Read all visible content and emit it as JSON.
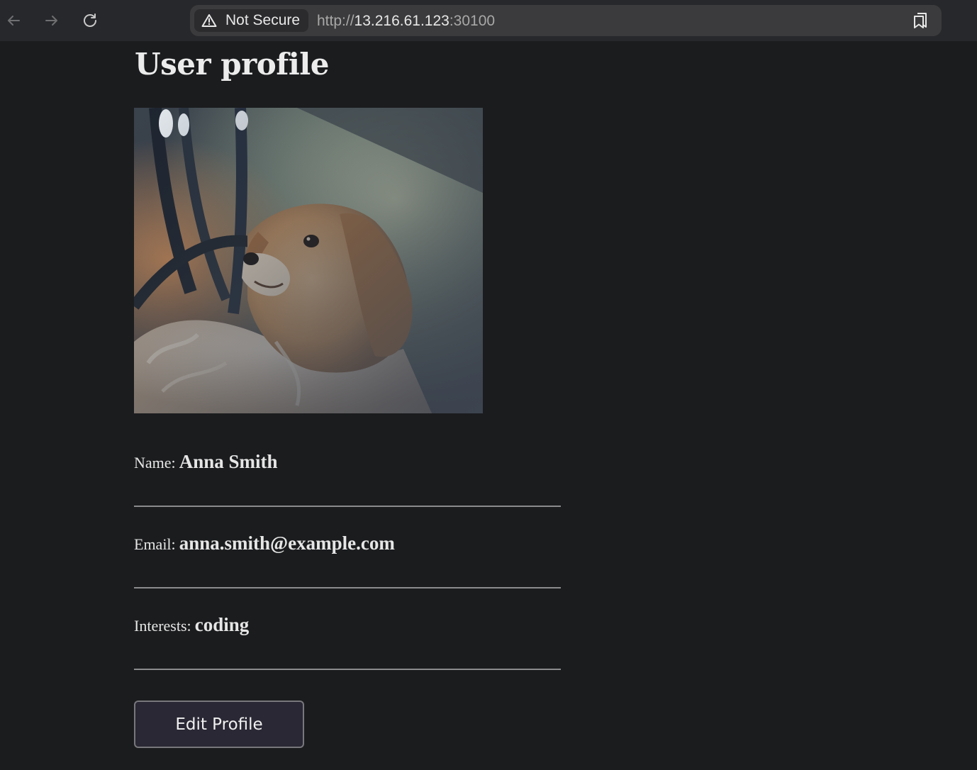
{
  "browser": {
    "security_label": "Not Secure",
    "url_scheme": "http://",
    "url_host": "13.216.61.123",
    "url_port": ":30100"
  },
  "page": {
    "title": "User profile",
    "fields": [
      {
        "label": "Name:",
        "value": "Anna Smith"
      },
      {
        "label": "Email:",
        "value": "anna.smith@example.com"
      },
      {
        "label": "Interests:",
        "value": "coding"
      }
    ],
    "edit_button_label": "Edit Profile",
    "photo_subject": "dog photo"
  },
  "colors": {
    "background": "#1b1c1e",
    "button_background": "#2a2834",
    "divider": "#8b8b8d"
  }
}
